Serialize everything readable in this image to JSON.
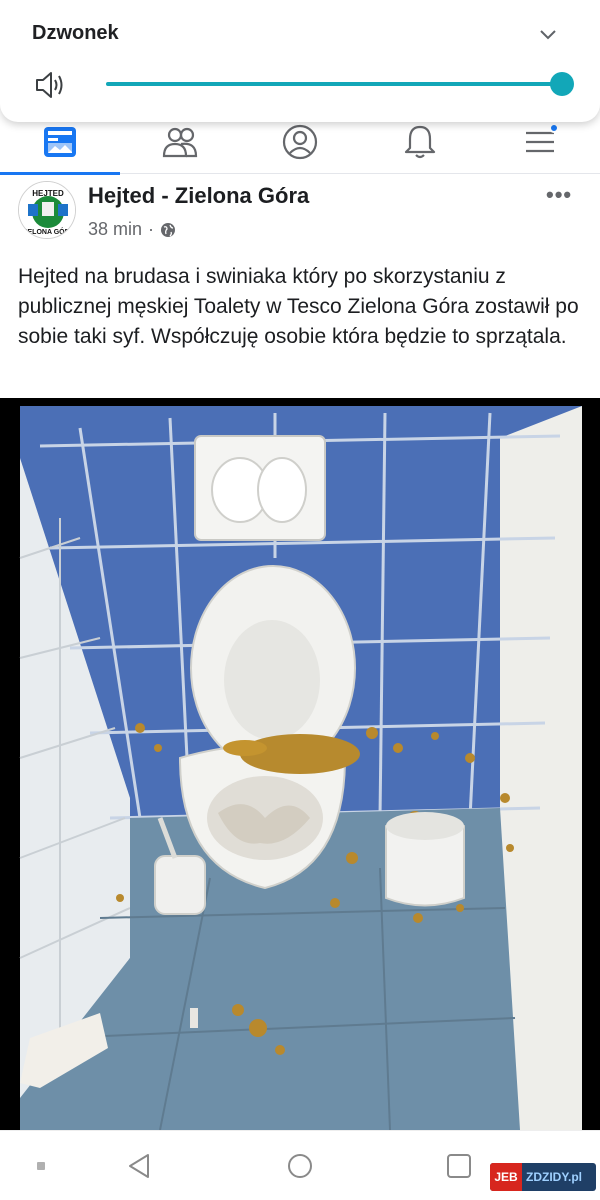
{
  "volume": {
    "title": "Dzwonek",
    "level_percent": 100,
    "accent_color": "#12a7b8",
    "icons": [
      "speaker-icon",
      "chevron-down-icon"
    ]
  },
  "fb_nav": {
    "items": [
      "news-feed-icon",
      "groups-icon",
      "profile-icon",
      "notifications-icon",
      "menu-icon"
    ],
    "active_index": 0,
    "accent_color": "#1877f2"
  },
  "post": {
    "page_name": "Hejted - Zielona Góra",
    "time": "38 min",
    "separator": "·",
    "privacy_icon": "globe-icon",
    "more_label": "•••",
    "avatar_lines": [
      "HEJTED",
      "ZIELONA GÓRA"
    ],
    "text": "Hejted na brudasa i swiniaka który po skorzystaniu z publicznej męskiej  Toalety w Tesco Zielona Góra zostawił po sobie taki syf. Współczuję osobie która będzie to sprzątala.",
    "photo": "toilet-stall-photo"
  },
  "system_nav": {
    "buttons": [
      "hide-keys-icon",
      "back-icon",
      "home-icon",
      "recents-icon"
    ]
  },
  "watermark": {
    "left": "JEB",
    "right": "ZDZIDY.pl"
  }
}
